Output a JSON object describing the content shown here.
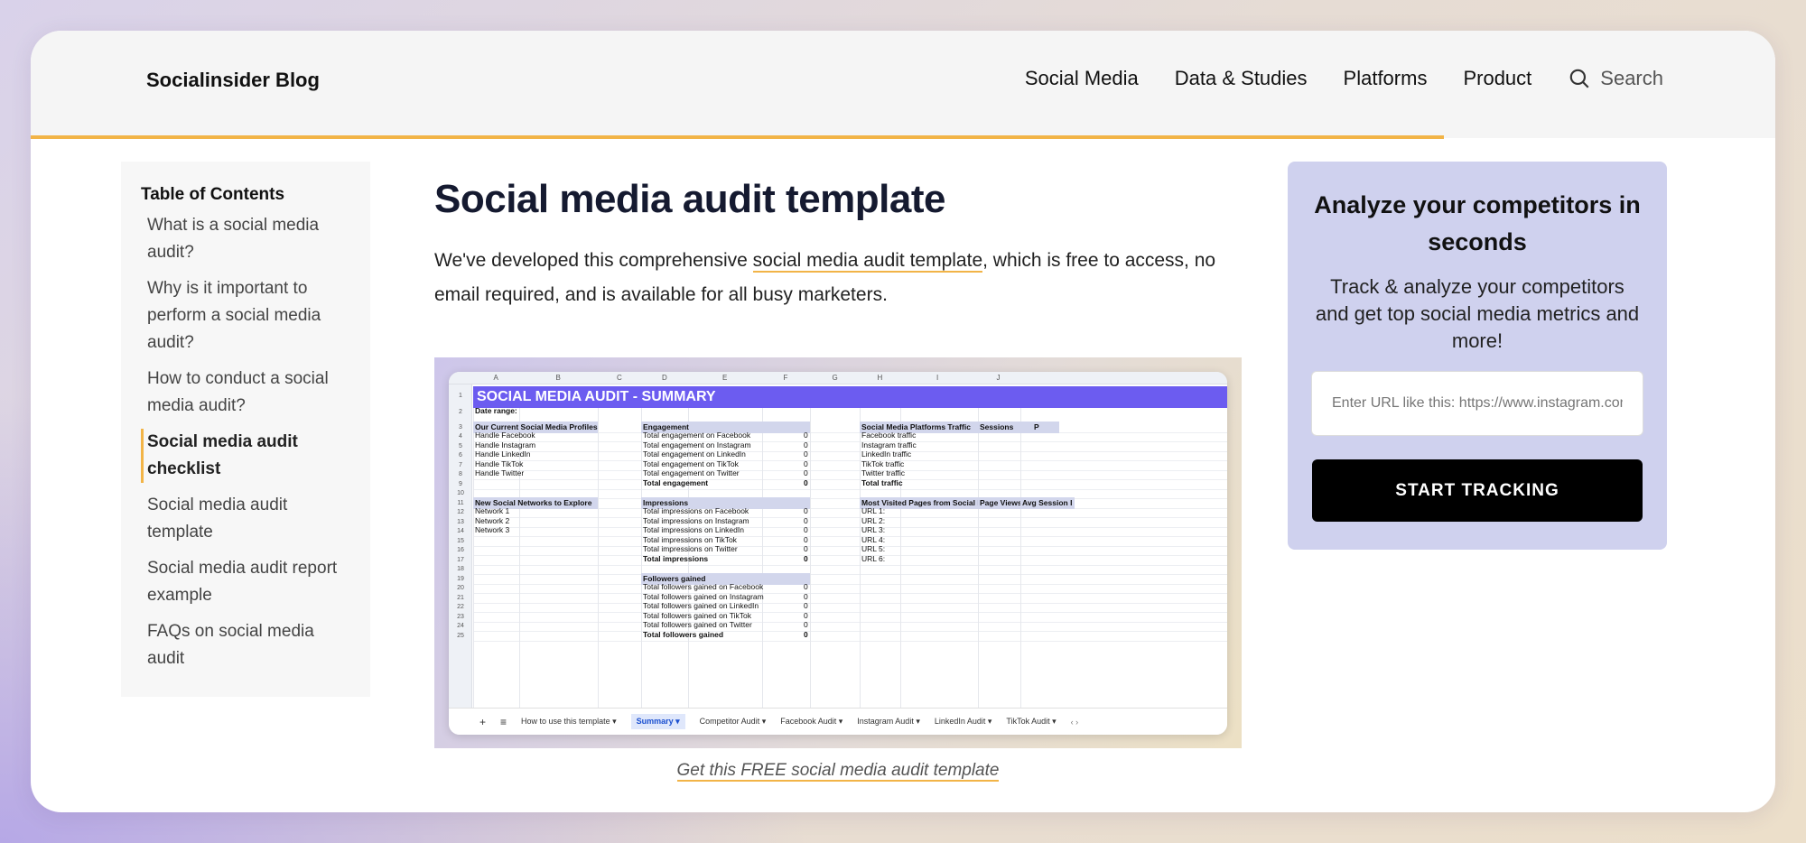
{
  "header": {
    "brand": "Socialinsider Blog",
    "nav": [
      "Social Media",
      "Data & Studies",
      "Platforms",
      "Product"
    ],
    "search_label": "Search",
    "read_progress": 0.81
  },
  "toc": {
    "title": "Table of Contents",
    "items": [
      "What is a social media audit?",
      "Why is it important to perform a social media audit?",
      "How to conduct a social media audit?",
      "Social media audit checklist",
      "Social media audit template",
      "Social media audit report example",
      "FAQs on social media audit"
    ],
    "active_index": 3
  },
  "article": {
    "title": "Social media audit template",
    "intro_before": "We've developed this comprehensive ",
    "intro_link": "social media audit template",
    "intro_after": ", which is free to access, no email required, and is available for all busy marketers.",
    "caption": "Get this FREE social media audit template"
  },
  "sheet": {
    "columns": [
      "A",
      "B",
      "C",
      "D",
      "E",
      "F",
      "G",
      "H",
      "I",
      "J"
    ],
    "title": "SOCIAL MEDIA AUDIT - SUMMARY",
    "date_range": "Date range:",
    "profiles_header": "Our Current Social Media Profiles",
    "profiles": [
      "Handle Facebook",
      "Handle Instagram",
      "Handle LinkedIn",
      "Handle TikTok",
      "Handle Twitter"
    ],
    "networks_header": "New Social Networks to Explore",
    "networks": [
      "Network 1",
      "Network 2",
      "Network 3"
    ],
    "engagement_header": "Engagement",
    "engagement": [
      "Total engagement on Facebook",
      "Total engagement on Instagram",
      "Total engagement on LinkedIn",
      "Total engagement on TikTok",
      "Total engagement on Twitter"
    ],
    "engagement_total": "Total engagement",
    "impressions_header": "Impressions",
    "impressions": [
      "Total impressions on Facebook",
      "Total impressions on Instagram",
      "Total impressions on LinkedIn",
      "Total impressions on TikTok",
      "Total impressions on Twitter"
    ],
    "impressions_total": "Total impressions",
    "followers_header": "Followers gained",
    "followers": [
      "Total followers gained on Facebook",
      "Total followers gained on Instagram",
      "Total followers gained on LinkedIn",
      "Total followers gained on TikTok",
      "Total followers gained on Twitter"
    ],
    "followers_total": "Total followers gained",
    "traffic_header": "Social Media Platforms Traffic",
    "sessions_header": "Sessions",
    "traffic": [
      "Facebook traffic",
      "Instagram traffic",
      "LinkedIn traffic",
      "TikTok traffic",
      "Twitter traffic"
    ],
    "traffic_total": "Total traffic",
    "pages_header": "Most Visited Pages from Social Media",
    "page_views_header": "Page Views",
    "avg_session_header": "Avg Session I",
    "urls": [
      "URL 1:",
      "URL 2:",
      "URL 3:",
      "URL 4:",
      "URL 5:",
      "URL 6:"
    ],
    "zero": "0",
    "tabs": [
      "How to use this template",
      "Summary",
      "Competitor Audit",
      "Facebook Audit",
      "Instagram Audit",
      "LinkedIn Audit",
      "TikTok Audit"
    ],
    "active_tab": 1
  },
  "promo": {
    "title": "Analyze your competitors in seconds",
    "text": "Track & analyze your competitors and get top social media metrics and more!",
    "input_placeholder": "Enter URL like this: https://www.instagram.com",
    "button": "START TRACKING"
  }
}
